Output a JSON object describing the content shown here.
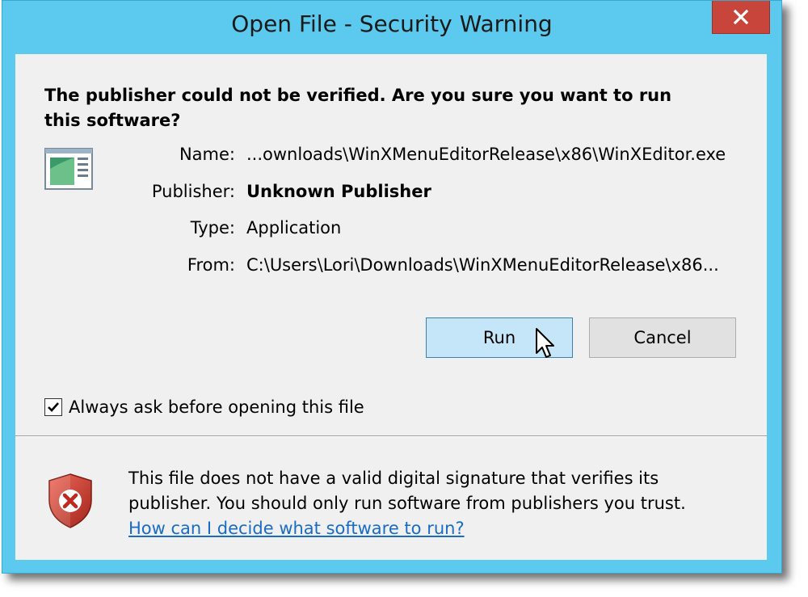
{
  "window": {
    "title": "Open File - Security Warning",
    "close_icon": "close-icon",
    "accent_color": "#5ccaee",
    "close_color": "#c7453a"
  },
  "main": {
    "question": "The publisher could not be verified.  Are you sure you want to run this software?",
    "file_icon": "application-icon",
    "details": [
      {
        "label": "Name:",
        "value": "...ownloads\\WinXMenuEditorRelease\\x86\\WinXEditor.exe"
      },
      {
        "label": "Publisher:",
        "value": "Unknown Publisher"
      },
      {
        "label": "Type:",
        "value": "Application"
      },
      {
        "label": "From:",
        "value": "C:\\Users\\Lori\\Downloads\\WinXMenuEditorRelease\\x86..."
      }
    ],
    "run_label": "Run",
    "cancel_label": "Cancel",
    "always_ask_label": "Always ask before opening this file",
    "always_ask_checked": true
  },
  "footer": {
    "shield_icon": "security-shield-error-icon",
    "warning_text": "This file does not have a valid digital signature that verifies its publisher.  You should only run software from publishers you trust.",
    "help_link": "How can I decide what software to run?",
    "link_color": "#1a6bc8"
  }
}
